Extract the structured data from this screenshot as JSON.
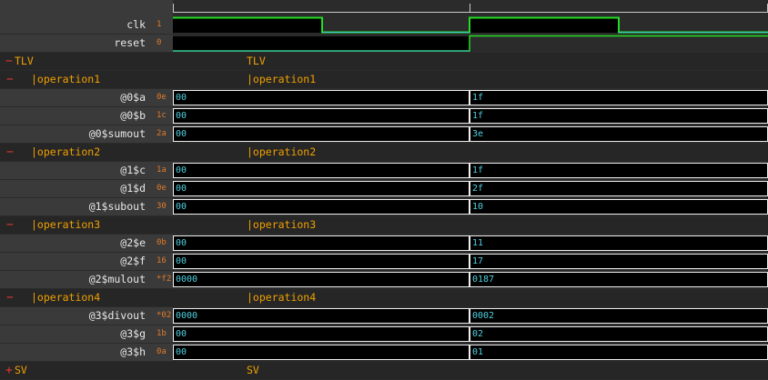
{
  "signals_top": [
    {
      "name": "clk",
      "value": "1"
    },
    {
      "name": "reset",
      "value": "0"
    }
  ],
  "scopes": [
    {
      "id": "tlv",
      "label": "TLV",
      "wave_label": "TLV",
      "sign": "−"
    },
    {
      "id": "op1",
      "label": "|operation1",
      "wave_label": "|operation1",
      "sign": "−",
      "signals": [
        {
          "name": "@0$a",
          "value": "0e",
          "seg1": "00",
          "seg2": "1f"
        },
        {
          "name": "@0$b",
          "value": "1c",
          "seg1": "00",
          "seg2": "1f"
        },
        {
          "name": "@0$sumout",
          "value": "2a",
          "seg1": "00",
          "seg2": "3e"
        }
      ]
    },
    {
      "id": "op2",
      "label": "|operation2",
      "wave_label": "|operation2",
      "sign": "−",
      "signals": [
        {
          "name": "@1$c",
          "value": "1a",
          "seg1": "00",
          "seg2": "1f"
        },
        {
          "name": "@1$d",
          "value": "0e",
          "seg1": "00",
          "seg2": "2f"
        },
        {
          "name": "@1$subout",
          "value": "30",
          "seg1": "00",
          "seg2": "10"
        }
      ]
    },
    {
      "id": "op3",
      "label": "|operation3",
      "wave_label": "|operation3",
      "sign": "−",
      "signals": [
        {
          "name": "@2$e",
          "value": "0b",
          "seg1": "00",
          "seg2": "11"
        },
        {
          "name": "@2$f",
          "value": "16",
          "seg1": "00",
          "seg2": "17"
        },
        {
          "name": "@2$mulout",
          "value": "*f2",
          "seg1": "0000",
          "seg2": "0187"
        }
      ]
    },
    {
      "id": "op4",
      "label": "|operation4",
      "wave_label": "|operation4",
      "sign": "−",
      "signals": [
        {
          "name": "@3$divout",
          "value": "*02",
          "seg1": "0000",
          "seg2": "0002"
        },
        {
          "name": "@3$g",
          "value": "1b",
          "seg1": "00",
          "seg2": "02"
        },
        {
          "name": "@3$h",
          "value": "0a",
          "seg1": "00",
          "seg2": "01"
        }
      ]
    },
    {
      "id": "sv",
      "label": "SV",
      "wave_label": "SV",
      "sign": "+"
    }
  ],
  "colors": {
    "wave_high": "#22dd22",
    "wave_low": "#3fc8d0",
    "value_text": "#4fd0e0",
    "scope_text": "#f0a000",
    "current_value": "#e07a2a"
  }
}
